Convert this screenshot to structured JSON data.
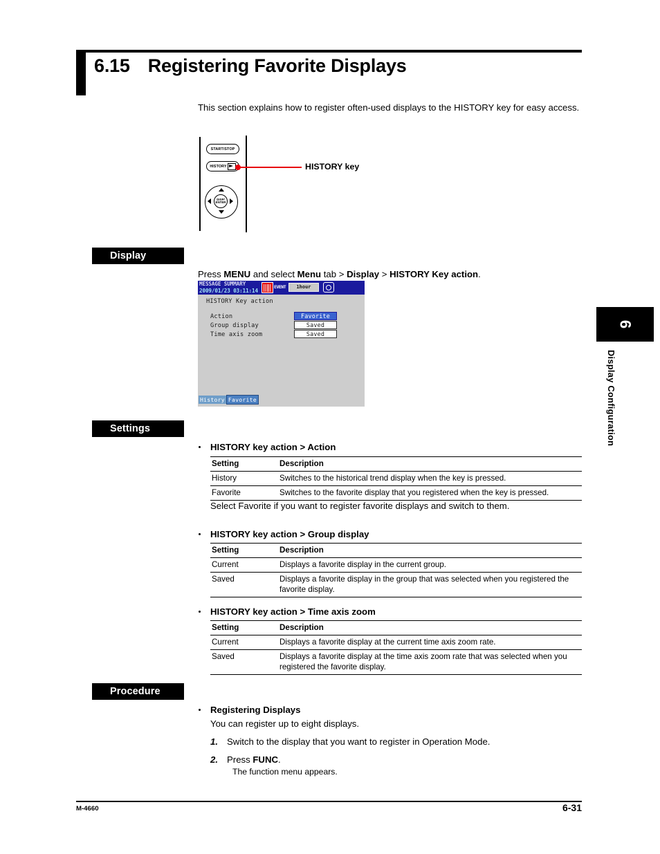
{
  "heading": {
    "number": "6.15",
    "title": "Registering Favorite Displays"
  },
  "intro": "This section explains how to register often-used displays to the HISTORY key for easy access.",
  "key_figure": {
    "buttons": {
      "start_stop": "START/STOP",
      "history": "HISTORY",
      "disp_enter_line1": "DISP/",
      "disp_enter_line2": "ENTER"
    },
    "callout_label": "HISTORY key",
    "callout_color": "#e8000d"
  },
  "sections": {
    "display_tag": "Display",
    "settings_tag": "Settings",
    "procedure_tag": "Procedure"
  },
  "display": {
    "lead_pre": "Press ",
    "lead_menu": "MENU",
    "lead_mid": " and select ",
    "lead_menutab": "Menu",
    "lead_tab": " tab > ",
    "lead_display": "Display",
    "lead_gt": " > ",
    "lead_history": "HISTORY Key action",
    "lead_end": "."
  },
  "lcd": {
    "title": "MESSAGE SUMMARY",
    "timestamp": "2009/01/23 03:11:14",
    "event_label": "EVENT",
    "span": "1hour",
    "alarm_icon": "alarm-icon",
    "gear_icon": "gear-icon",
    "heading": "HISTORY Key action",
    "rows": [
      {
        "label": "Action",
        "value": "Favorite",
        "selected": true
      },
      {
        "label": "Group display",
        "value": "Saved",
        "selected": false
      },
      {
        "label": "Time axis zoom",
        "value": "Saved",
        "selected": false
      }
    ],
    "tabs": [
      {
        "label": "History",
        "active": false
      },
      {
        "label": "Favorite",
        "active": true
      }
    ],
    "colors": {
      "header_bg": "#1b1b9e",
      "body_bg": "#cdcdcd",
      "select_bg": "#3a63cf",
      "alarm": "#e00000"
    }
  },
  "settings": {
    "block1": {
      "heading": "HISTORY key action > Action",
      "columns": [
        "Setting",
        "Description"
      ],
      "rows": [
        [
          "History",
          "Switches to the historical trend display when the key is pressed."
        ],
        [
          "Favorite",
          "Switches to the favorite display that you registered when the key is pressed."
        ]
      ],
      "note": "Select Favorite if you want to register favorite displays and switch to them."
    },
    "block2": {
      "heading": "HISTORY key action > Group display",
      "columns": [
        "Setting",
        "Description"
      ],
      "rows": [
        [
          "Current",
          "Displays a favorite display in the current group."
        ],
        [
          "Saved",
          "Displays a favorite display in the group that was selected when you registered the favorite display."
        ]
      ]
    },
    "block3": {
      "heading": "HISTORY key action > Time axis zoom",
      "columns": [
        "Setting",
        "Description"
      ],
      "rows": [
        [
          "Current",
          "Displays a favorite display at the current time axis zoom rate."
        ],
        [
          "Saved",
          "Displays a favorite display at the time axis zoom rate that was selected when you registered the favorite display."
        ]
      ]
    }
  },
  "procedure": {
    "heading": "Registering Displays",
    "subtitle": "You can register up to eight displays.",
    "steps": [
      {
        "n": "1.",
        "pre": "Switch to the display that you want to register in Operation Mode.",
        "bold": "",
        "post": ""
      },
      {
        "n": "2.",
        "pre": "Press ",
        "bold": "FUNC",
        "post": "."
      }
    ],
    "step2_note": "The function menu appears."
  },
  "side_tab": {
    "chapter": "6",
    "label": "Display Configuration"
  },
  "footer": {
    "manual": "M-4660",
    "page": "6-31"
  }
}
